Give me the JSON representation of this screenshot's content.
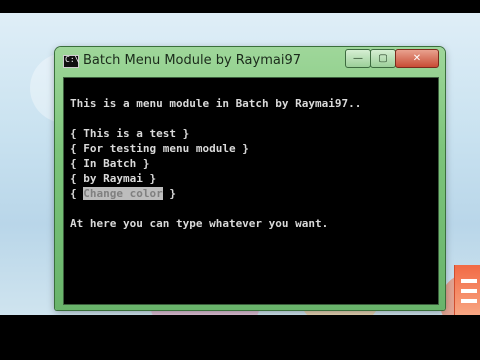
{
  "window": {
    "title": "Batch Menu Module by Raymai97",
    "icon": "cmd-icon",
    "icon_glyph": "C:\\",
    "controls": {
      "minimize": "—",
      "maximize": "▢",
      "close": "✕"
    }
  },
  "console": {
    "header": "This is a menu module in Batch by Raymai97..",
    "menu": [
      {
        "open": "{ ",
        "label": "This is a test",
        "close": " }"
      },
      {
        "open": "{ ",
        "label": "For testing menu module",
        "close": " }"
      },
      {
        "open": "{ ",
        "label": "In Batch",
        "close": " }"
      },
      {
        "open": "{ ",
        "label": "by Raymai",
        "close": " }"
      },
      {
        "open": "{ ",
        "label": "Change color",
        "close": " }",
        "selected": true
      }
    ],
    "footer": "At here you can type whatever you want."
  },
  "colors": {
    "console_bg": "#000000",
    "console_text": "#d9d9d9",
    "highlight_bg": "#bdbdbd",
    "highlight_text": "#808080",
    "window_frame": "#7cc47a"
  }
}
